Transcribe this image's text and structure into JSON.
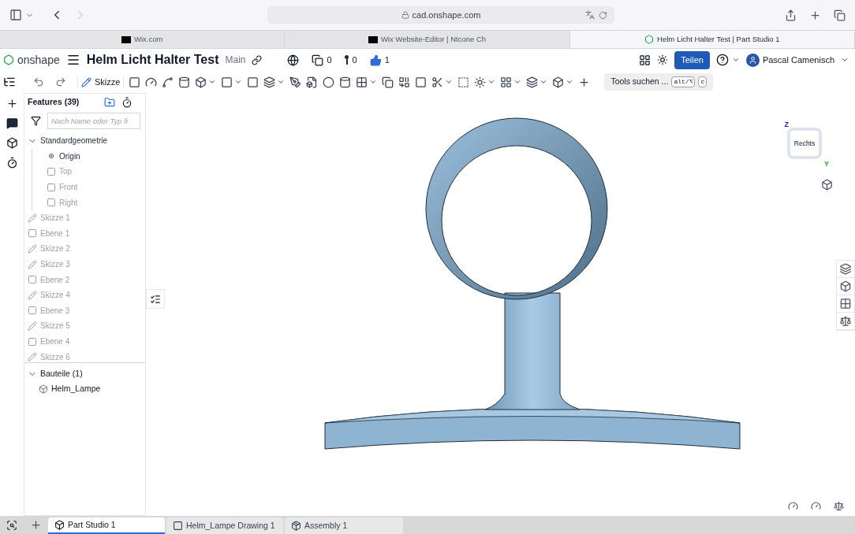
{
  "browser": {
    "url": "cad.onshape.com",
    "tabs": [
      {
        "label": "Wix.com",
        "kind": "wix",
        "selected": false
      },
      {
        "label": "Wix Website-Editor | Ntcone Ch",
        "kind": "wix",
        "selected": false
      },
      {
        "label": "Helm Licht Halter Test | Part Studio 1",
        "kind": "onshape",
        "selected": true
      }
    ]
  },
  "header": {
    "logo": "onshape",
    "title": "Helm Licht Halter Test",
    "branch": "Main",
    "counters": [
      {
        "kind": "versions",
        "value": "0"
      },
      {
        "kind": "branches",
        "value": "0"
      },
      {
        "kind": "likes",
        "value": "1"
      }
    ],
    "share_button": "Teilen",
    "user": "Pascal Camenisch"
  },
  "toolbar": {
    "sketch_button": "Skizze",
    "search_label": "Tools suchen ...",
    "shortcut_keys": [
      "alt/⌥",
      "c"
    ]
  },
  "features": {
    "title": "Features (39)",
    "filter_placeholder": "Nach Name oder Typ fi",
    "tree": [
      {
        "label": "Standardgeometrie",
        "kind": "group",
        "greyed": false,
        "expanded": true,
        "children": [
          {
            "label": "Origin",
            "kind": "point",
            "greyed": false
          },
          {
            "label": "Top",
            "kind": "plane",
            "greyed": true
          },
          {
            "label": "Front",
            "kind": "plane",
            "greyed": true
          },
          {
            "label": "Right",
            "kind": "plane",
            "greyed": true
          }
        ]
      },
      {
        "label": "Skizze 1",
        "kind": "sketch",
        "greyed": true
      },
      {
        "label": "Ebene 1",
        "kind": "plane",
        "greyed": true
      },
      {
        "label": "Skizze 2",
        "kind": "sketch",
        "greyed": true
      },
      {
        "label": "Skizze 3",
        "kind": "sketch",
        "greyed": true
      },
      {
        "label": "Ebene 2",
        "kind": "plane",
        "greyed": true
      },
      {
        "label": "Skizze 4",
        "kind": "sketch",
        "greyed": true
      },
      {
        "label": "Ebene 3",
        "kind": "plane",
        "greyed": true
      },
      {
        "label": "Skizze 5",
        "kind": "sketch",
        "greyed": true
      },
      {
        "label": "Ebene 4",
        "kind": "plane",
        "greyed": true
      },
      {
        "label": "Skizze 6",
        "kind": "sketch",
        "greyed": true
      }
    ],
    "parts": {
      "label": "Bauteile (1)",
      "expanded": true,
      "items": [
        {
          "label": "Helm_Lampe"
        }
      ]
    }
  },
  "view_cube": {
    "face": "Rechts",
    "axes": [
      "Z",
      "Y"
    ]
  },
  "bottom_tabs": [
    {
      "label": "Part Studio 1",
      "kind": "partstudio",
      "selected": true
    },
    {
      "label": "Helm_Lampe Drawing 1",
      "kind": "drawing",
      "selected": false
    },
    {
      "label": "Assembly 1",
      "kind": "assembly",
      "selected": false
    }
  ]
}
